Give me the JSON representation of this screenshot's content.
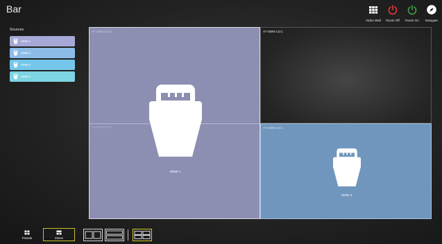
{
  "header": {
    "title": "Bar",
    "actions": [
      {
        "label": "Video Wall",
        "icon": "grid-icon",
        "color": "#ffffff"
      },
      {
        "label": "Room Off",
        "icon": "power-icon",
        "color": "#e53935"
      },
      {
        "label": "Room On",
        "icon": "power-icon",
        "color": "#43a047"
      },
      {
        "label": "Navigate",
        "icon": "compass-icon",
        "color": "#ffffff"
      }
    ]
  },
  "sidebar": {
    "title": "Sources",
    "items": [
      {
        "label": "HDMI 1",
        "color": "#a6a8d8"
      },
      {
        "label": "HDMI 2",
        "color": "#8bbde8"
      },
      {
        "label": "HDMI 1",
        "color": "#74c7ea"
      },
      {
        "label": "HDMI 2",
        "color": "#7dd4e2"
      }
    ]
  },
  "wall": {
    "zones": [
      {
        "id": "AT-OMNI-122:2",
        "source": "HDMI 1",
        "color": "#8c8fb2"
      },
      {
        "id": "AT-OMNI-122:1",
        "source": "",
        "color": "#2a2a2a"
      },
      {
        "id": "AT-OMNI-122:3",
        "source": "",
        "color": "#8c8fb2"
      },
      {
        "id": "AT-OMNI-122:1",
        "source": "HDMI 2",
        "color": "#7096bd"
      }
    ]
  },
  "footer": {
    "presets_label": "Presets",
    "zones_label": "Zones",
    "selected_layout": 2,
    "accent": "#d8cc28"
  }
}
